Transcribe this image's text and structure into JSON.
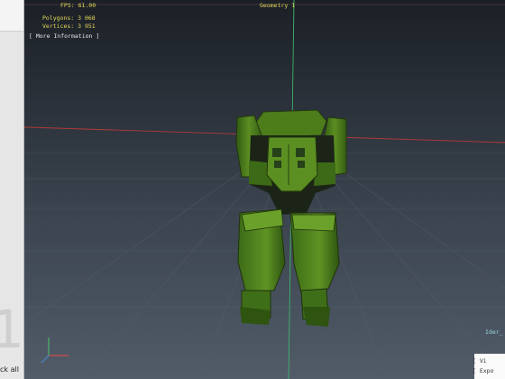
{
  "hud": {
    "fps": "FPS: 61.00",
    "polygons": "Polygons: 3 068",
    "vertices": "Vertices: 3 951",
    "more_info": "[ More Information ]",
    "top_center_label": "Geometry 1"
  },
  "right_panel": {
    "node_label": "Ider_",
    "view_label": "[ Vi",
    "export_label": "[ Expo"
  },
  "left_panel": {
    "big_digit": "1",
    "bottom_label": "ck all"
  },
  "colors": {
    "viewport_top": "#1c2026",
    "viewport_bottom": "#525c68",
    "grid_axis_red": "#b33a3a",
    "grid_axis_green": "#3fb36b",
    "model_green": "#4a7a1c",
    "model_dark": "#1c2a12",
    "hud_text": "#e6d95a"
  },
  "icons": {
    "axis_gizmo": "axis-gizmo-icon"
  }
}
